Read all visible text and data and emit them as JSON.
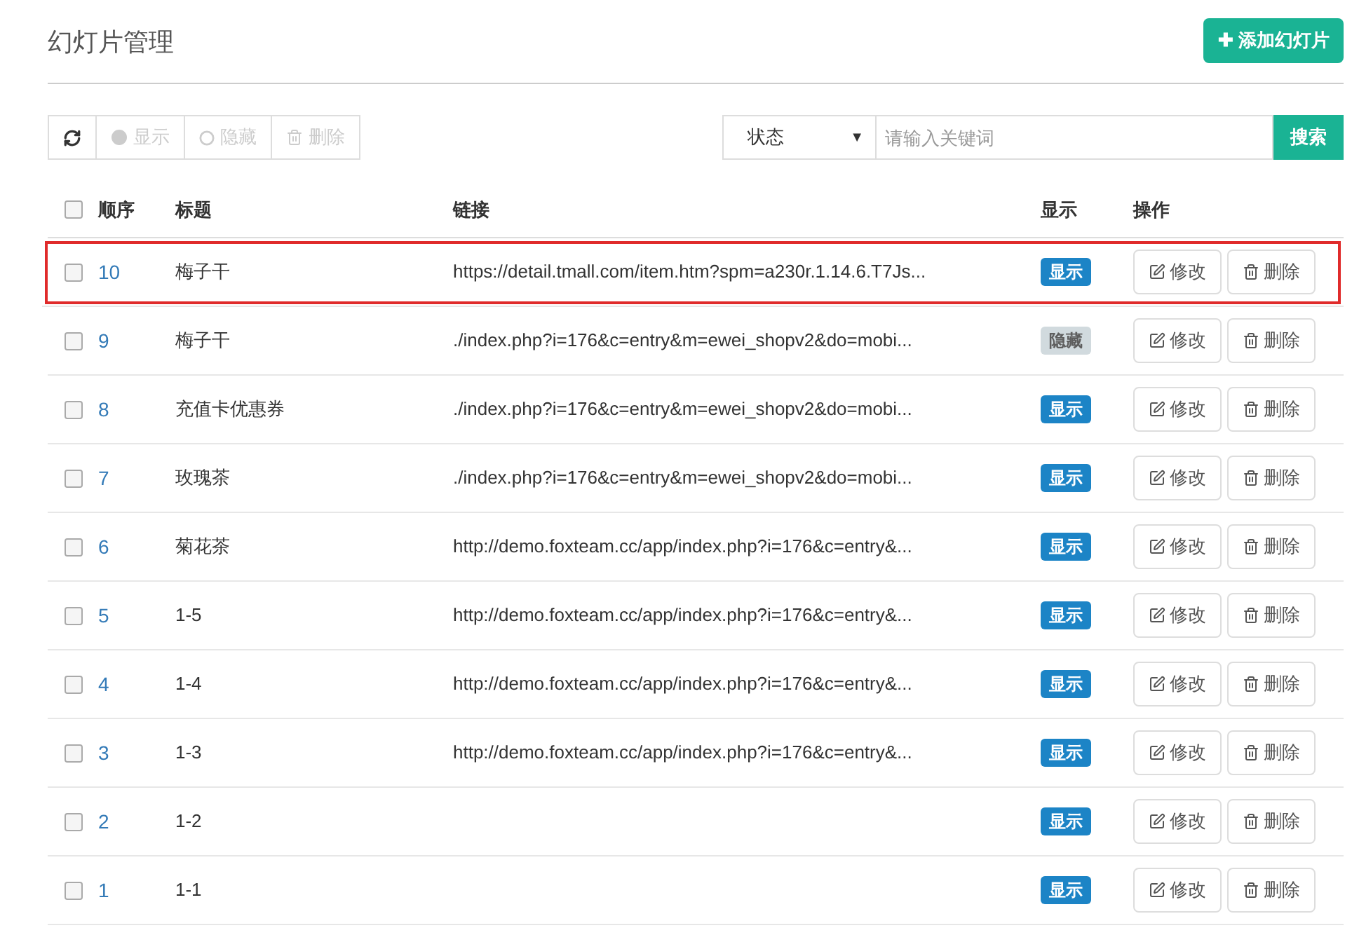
{
  "page": {
    "title": "幻灯片管理",
    "add_button": "✚ 添加幻灯片"
  },
  "toolbar": {
    "buttons": [
      {
        "kind": "refresh",
        "disabled": false
      },
      {
        "kind": "show",
        "label": "显示",
        "disabled": true
      },
      {
        "kind": "hide",
        "label": "隐藏",
        "disabled": true
      },
      {
        "kind": "delete",
        "label": "删除",
        "disabled": true
      }
    ],
    "status_select": "状态",
    "select_arrow": "▼",
    "select_all_checked": false,
    "search": {
      "placeholder": "请输入关键词"
    },
    "search_button": "搜索"
  },
  "table": {
    "columns": [
      "顺序",
      "标题",
      "链接",
      "显示",
      "操作"
    ],
    "rows": [
      {
        "order": "10",
        "title": "梅子干",
        "link": "https://detail.tmall.com/item.htm?spm=a230r.1.14.6.T7Js...",
        "visible": true,
        "status": "显示",
        "highlighted": true,
        "checked": false,
        "edit": "修改",
        "delete": "删除"
      },
      {
        "order": "9",
        "title": "梅子干",
        "link": "./index.php?i=176&c=entry&m=ewei_shopv2&do=mobi...",
        "visible": false,
        "status": "隐藏",
        "highlighted": false,
        "checked": false,
        "edit": "修改",
        "delete": "删除"
      },
      {
        "order": "8",
        "title": "充值卡优惠券",
        "link": "./index.php?i=176&c=entry&m=ewei_shopv2&do=mobi...",
        "visible": true,
        "status": "显示",
        "highlighted": false,
        "checked": false,
        "edit": "修改",
        "delete": "删除"
      },
      {
        "order": "7",
        "title": "玫瑰茶",
        "link": "./index.php?i=176&c=entry&m=ewei_shopv2&do=mobi...",
        "visible": true,
        "status": "显示",
        "highlighted": false,
        "checked": false,
        "edit": "修改",
        "delete": "删除"
      },
      {
        "order": "6",
        "title": "菊花茶",
        "link": "http://demo.foxteam.cc/app/index.php?i=176&c=entry&...",
        "visible": true,
        "status": "显示",
        "highlighted": false,
        "checked": false,
        "edit": "修改",
        "delete": "删除"
      },
      {
        "order": "5",
        "title": "1-5",
        "link": "http://demo.foxteam.cc/app/index.php?i=176&c=entry&...",
        "visible": true,
        "status": "显示",
        "highlighted": false,
        "checked": false,
        "edit": "修改",
        "delete": "删除"
      },
      {
        "order": "4",
        "title": "1-4",
        "link": "http://demo.foxteam.cc/app/index.php?i=176&c=entry&...",
        "visible": true,
        "status": "显示",
        "highlighted": false,
        "checked": false,
        "edit": "修改",
        "delete": "删除"
      },
      {
        "order": "3",
        "title": "1-3",
        "link": "http://demo.foxteam.cc/app/index.php?i=176&c=entry&...",
        "visible": true,
        "status": "显示",
        "highlighted": false,
        "checked": false,
        "edit": "修改",
        "delete": "删除"
      },
      {
        "order": "2",
        "title": "1-2",
        "visible": true,
        "status": "显示",
        "highlighted": false,
        "checked": false,
        "edit": "修改",
        "delete": "删除"
      },
      {
        "order": "1",
        "title": "1-1",
        "visible": true,
        "status": "显示",
        "highlighted": false,
        "checked": false,
        "edit": "修改",
        "delete": "删除"
      }
    ]
  }
}
